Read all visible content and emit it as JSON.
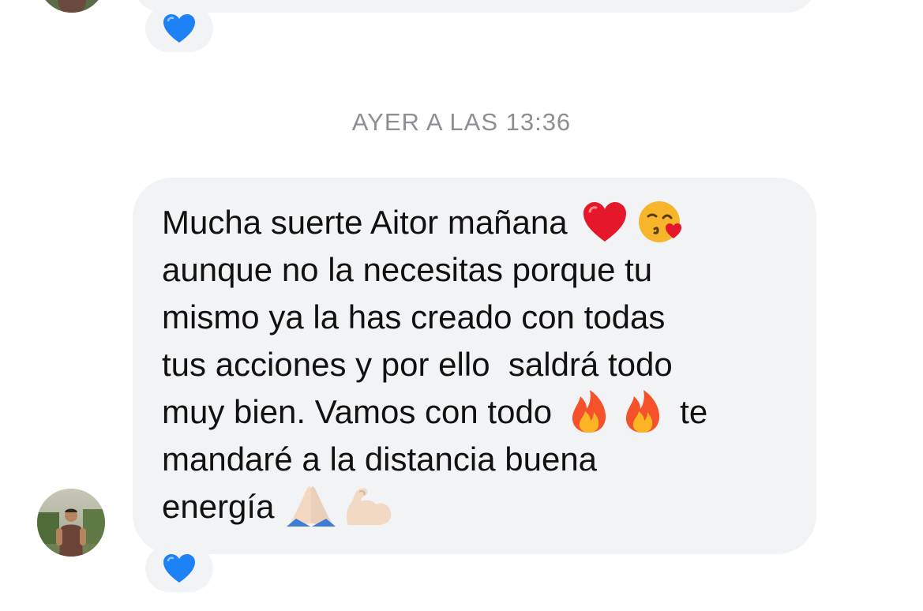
{
  "timestamp": "AYER A LAS 13:36",
  "message": {
    "lines": [
      "Mucha suerte Aitor mañana",
      "aunque no la necesitas porque tu",
      "mismo ya la has creado con todas",
      "tus acciones y por ello  saldrá todo",
      "muy bien. Vamos con todo",
      "te",
      "mandaré a la distancia buena",
      "energía"
    ]
  },
  "reactions": {
    "previous": "blue-heart",
    "current": "blue-heart"
  },
  "emojis": [
    "red-heart",
    "face-blowing-kiss",
    "fire",
    "fire",
    "folded-hands",
    "flexed-biceps"
  ],
  "colors": {
    "bubble": "#f2f3f5",
    "timestamp": "#8e8e93",
    "text": "#111111",
    "reaction_heart": "#1d82f5"
  }
}
